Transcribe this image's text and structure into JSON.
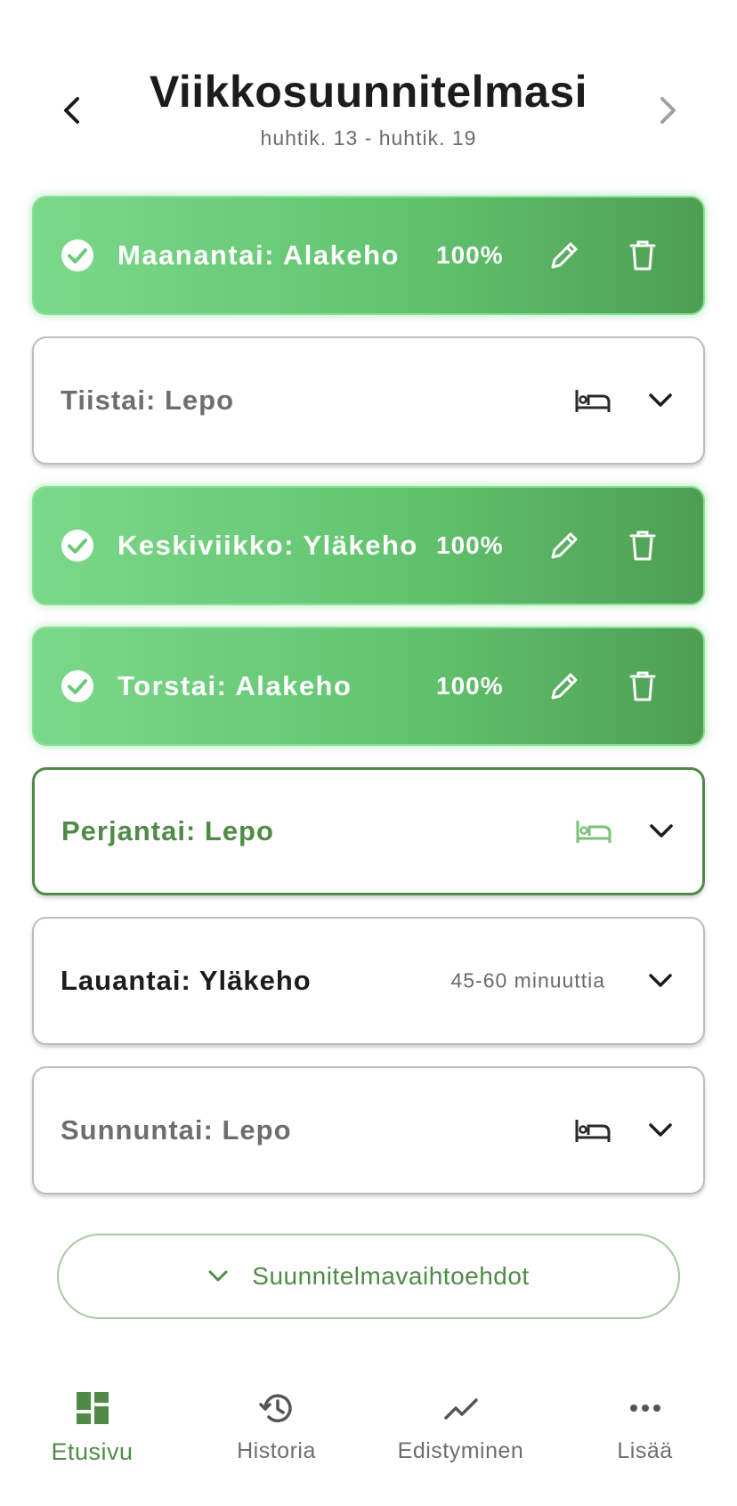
{
  "header": {
    "title": "Viikkosuunnitelmasi",
    "date_range": "huhtik. 13 - huhtik. 19"
  },
  "days": [
    {
      "label": "Maanantai: Alakeho",
      "status": "completed",
      "progress": "100%"
    },
    {
      "label": "Tiistai: Lepo",
      "status": "rest"
    },
    {
      "label": "Keskiviikko: Yläkeho",
      "status": "completed",
      "progress": "100%"
    },
    {
      "label": "Torstai: Alakeho",
      "status": "completed",
      "progress": "100%"
    },
    {
      "label": "Perjantai: Lepo",
      "status": "rest-today"
    },
    {
      "label": "Lauantai: Yläkeho",
      "status": "planned",
      "duration": "45-60 minuuttia"
    },
    {
      "label": "Sunnuntai: Lepo",
      "status": "rest"
    }
  ],
  "plan_options": {
    "label": "Suunnitelmavaihtoehdot"
  },
  "bottom_nav": {
    "items": [
      {
        "label": "Etusivu",
        "icon": "dashboard-icon",
        "selected": true
      },
      {
        "label": "Historia",
        "icon": "history-icon",
        "selected": false
      },
      {
        "label": "Edistyminen",
        "icon": "trending-icon",
        "selected": false
      },
      {
        "label": "Lisää",
        "icon": "more-icon",
        "selected": false
      }
    ]
  },
  "colors": {
    "accent_green": "#4f8b47",
    "completed_gradient_start": "#7bd88a",
    "completed_gradient_end": "#4e9e52",
    "muted_text": "#6e6e6e"
  }
}
